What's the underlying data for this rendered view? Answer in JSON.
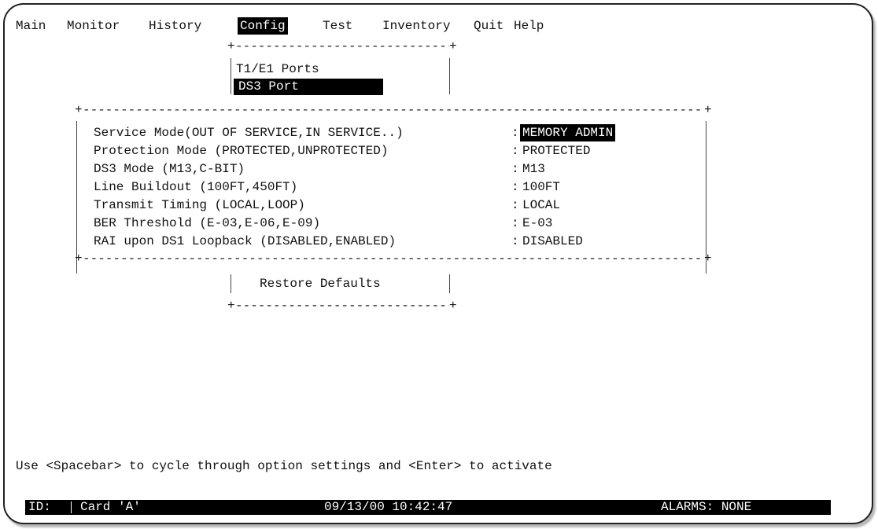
{
  "menubar": {
    "items": [
      "Main",
      "Monitor",
      "History",
      "Config",
      "Test",
      "Inventory",
      "Quit",
      "Help"
    ],
    "selected": "Config"
  },
  "config_menu": {
    "items": [
      "T1/E1 Ports",
      "DS3 Port"
    ],
    "selected": "DS3 Port"
  },
  "ds3_settings": {
    "rows": [
      {
        "label": "Service Mode(OUT OF SERVICE,IN SERVICE..)",
        "value": "MEMORY ADMIN"
      },
      {
        "label": "Protection Mode (PROTECTED,UNPROTECTED)",
        "value": "PROTECTED"
      },
      {
        "label": "DS3 Mode (M13,C-BIT)",
        "value": "M13"
      },
      {
        "label": "Line Buildout (100FT,450FT)",
        "value": "100FT"
      },
      {
        "label": "Transmit Timing (LOCAL,LOOP)",
        "value": "LOCAL"
      },
      {
        "label": "BER Threshold (E-03,E-06,E-09)",
        "value": "E-03"
      },
      {
        "label": "RAI upon DS1 Loopback (DISABLED,ENABLED)",
        "value": "DISABLED"
      }
    ],
    "restore_label": "Restore Defaults"
  },
  "help_text": "Use <Spacebar> to cycle through option settings and <Enter> to activate",
  "status_bar": {
    "id_label": "ID:",
    "card": "Card 'A'",
    "datetime": "09/13/00 10:42:47",
    "alarms": "ALARMS: NONE"
  },
  "dash_char": "-",
  "corner_char": "+",
  "separator": ":",
  "colors": {
    "background": "#ffffff",
    "text": "#111111",
    "highlight": "#000000"
  }
}
